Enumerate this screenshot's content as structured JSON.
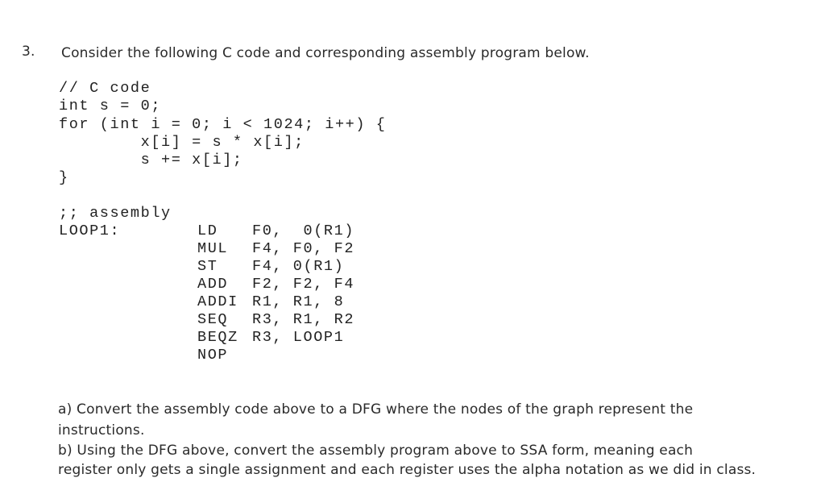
{
  "question": {
    "number": "3.",
    "intro": "Consider the following C code and corresponding assembly program below."
  },
  "c_code": {
    "lines": [
      "// C code",
      "int s = 0;",
      "for (int i = 0; i < 1024; i++) {",
      "        x[i] = s * x[i];",
      "        s += x[i];",
      "}"
    ]
  },
  "assembly": {
    "comment": ";; assembly",
    "label": "LOOP1:",
    "instructions": [
      {
        "op": "LD",
        "args": "F0,  0(R1)"
      },
      {
        "op": "MUL",
        "args": "F4, F0, F2"
      },
      {
        "op": "ST",
        "args": "F4, 0(R1)"
      },
      {
        "op": "ADD",
        "args": "F2, F2, F4"
      },
      {
        "op": "ADDI",
        "args": "R1, R1, 8"
      },
      {
        "op": "SEQ",
        "args": "R3, R1, R2"
      },
      {
        "op": "BEQZ",
        "args": "R3, LOOP1"
      },
      {
        "op": "NOP",
        "args": ""
      }
    ]
  },
  "parts": {
    "a_line1": "a)  Convert the assembly code above to a DFG where the nodes of the graph represent the",
    "a_line2": "instructions.",
    "b_line1": "b) Using the DFG above, convert the assembly program above to SSA form, meaning each",
    "b_line2": "register only gets a single assignment and each register uses the alpha notation as we did in class."
  }
}
